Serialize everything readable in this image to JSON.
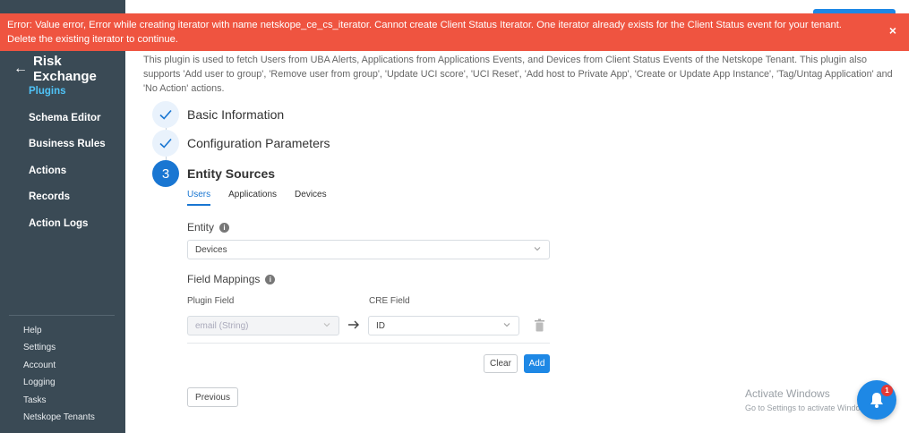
{
  "sidebar": {
    "title": "Risk Exchange",
    "items": [
      {
        "label": "Plugins",
        "active": true
      },
      {
        "label": "Schema Editor"
      },
      {
        "label": "Business Rules"
      },
      {
        "label": "Actions"
      },
      {
        "label": "Records"
      },
      {
        "label": "Action Logs"
      }
    ],
    "bottom_items": [
      "Help",
      "Settings",
      "Account",
      "Logging",
      "Tasks",
      "Netskope Tenants"
    ]
  },
  "error": {
    "message": "Error: Value error, Error while creating iterator with name netskope_ce_cs_iterator. Cannot create Client Status Iterator. One iterator already exists for the Client Status event for your tenant. Delete the existing iterator to continue.",
    "close": "×",
    "color": "#ef5440"
  },
  "description": "This plugin is used to fetch Users from UBA Alerts, Applications from Applications Events, and Devices from Client Status Events of the Netskope Tenant. This plugin also supports 'Add user to group', 'Remove user from group', 'Update UCI score', 'UCI Reset', 'Add host to Private App', 'Create or Update App Instance', 'Tag/Untag Application' and 'No Action' actions.",
  "steps": [
    {
      "title": "Basic Information",
      "state": "done"
    },
    {
      "title": "Configuration Parameters",
      "state": "done"
    },
    {
      "number": "3",
      "title": "Entity Sources",
      "state": "current"
    }
  ],
  "tabs": [
    {
      "label": "Users",
      "active": true
    },
    {
      "label": "Applications"
    },
    {
      "label": "Devices"
    }
  ],
  "entity": {
    "label": "Entity",
    "value": "Devices"
  },
  "field_mappings": {
    "label": "Field Mappings",
    "plugin_field_label": "Plugin Field",
    "cre_field_label": "CRE Field",
    "plugin_field_value": "email (String)",
    "cre_field_value": "ID"
  },
  "buttons": {
    "clear": "Clear",
    "add": "Add",
    "previous": "Previous"
  },
  "watermark": {
    "line1": "Activate Windows",
    "line2": "Go to Settings to activate Windows."
  },
  "notifications": {
    "badge": "1"
  },
  "colors": {
    "sidebar": "#3a4a55",
    "accent": "#1e88e5",
    "active_nav": "#4fc3f7"
  }
}
